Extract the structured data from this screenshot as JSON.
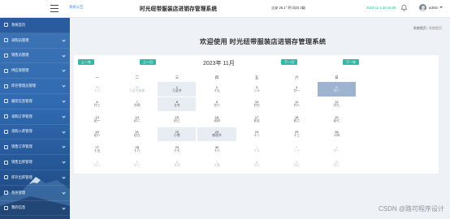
{
  "header": {
    "notice": "系统公告",
    "title": "时光纽带服装店进销存管理系统",
    "weather": "吉安  26.1°  阴  风向 2级",
    "datetime": "2023-11-1 20:18:29",
    "username": "admin"
  },
  "sidebar": {
    "items": [
      {
        "label": "系统首页",
        "active": true
      },
      {
        "label": "采购员管理"
      },
      {
        "label": "销售员管理"
      },
      {
        "label": "供应商管理"
      },
      {
        "label": "库存管理员管理"
      },
      {
        "label": "服装信息管理"
      },
      {
        "label": "采购订单管理"
      },
      {
        "label": "采购入库管理"
      },
      {
        "label": "销售订单管理"
      },
      {
        "label": "销售出库管理"
      },
      {
        "label": "库存出库管理"
      },
      {
        "label": "系统管理"
      },
      {
        "label": "我的信息"
      }
    ]
  },
  "breadcrumb": {
    "home": "系统首页",
    "current": "系统首页"
  },
  "welcome": "欢迎使用 时光纽带服装店进销存管理系统",
  "calendar": {
    "prev_year": "上一年",
    "prev_month": "上一月",
    "title": "2023年 11月",
    "next_month": "下一月",
    "next_year": "下一年",
    "weekdays": [
      "一",
      "二",
      "三",
      "四",
      "五",
      "六",
      "日"
    ],
    "weeks": [
      [
        {
          "d": "30",
          "l": "十六",
          "o": true
        },
        {
          "d": "31",
          "l": "万圣节前夜",
          "o": true
        },
        {
          "d": "1",
          "l": "万圣节",
          "h": true
        },
        {
          "d": "2",
          "l": "十九"
        },
        {
          "d": "3",
          "l": "二十"
        },
        {
          "d": "4",
          "l": "廿一"
        },
        {
          "d": "5",
          "l": "廿二",
          "s": true
        }
      ],
      [
        {
          "d": "6",
          "l": "廿三"
        },
        {
          "d": "7",
          "l": "廿四"
        },
        {
          "d": "8",
          "l": "立冬",
          "h": true
        },
        {
          "d": "9",
          "l": "廿六"
        },
        {
          "d": "10",
          "l": "廿七"
        },
        {
          "d": "11",
          "l": "廿八"
        },
        {
          "d": "12",
          "l": "廿九"
        }
      ],
      [
        {
          "d": "13",
          "l": "初一"
        },
        {
          "d": "14",
          "l": "初二"
        },
        {
          "d": "15",
          "l": "初三"
        },
        {
          "d": "16",
          "l": "初四"
        },
        {
          "d": "17",
          "l": "初五"
        },
        {
          "d": "18",
          "l": "初六"
        },
        {
          "d": "19",
          "l": "初七"
        }
      ],
      [
        {
          "d": "20",
          "l": "初八"
        },
        {
          "d": "21",
          "l": "初九"
        },
        {
          "d": "22",
          "l": "小雪",
          "h": true
        },
        {
          "d": "23",
          "l": "感恩节",
          "h": true
        },
        {
          "d": "24",
          "l": "十二"
        },
        {
          "d": "25",
          "l": "十三"
        },
        {
          "d": "26",
          "l": "十四"
        }
      ],
      [
        {
          "d": "27",
          "l": "十五"
        },
        {
          "d": "28",
          "l": "十六"
        },
        {
          "d": "29",
          "l": "十七"
        },
        {
          "d": "30",
          "l": "十八"
        },
        {
          "d": "1",
          "l": "十九",
          "o": true
        },
        {
          "d": "2",
          "l": "二十",
          "o": true
        },
        {
          "d": "3",
          "l": "廿一",
          "o": true
        }
      ],
      [
        {
          "d": "4",
          "l": "廿二",
          "o": true
        },
        {
          "d": "5",
          "l": "廿三",
          "o": true
        },
        {
          "d": "6",
          "l": "廿四",
          "o": true
        },
        {
          "d": "7",
          "l": "大雪",
          "o": true
        },
        {
          "d": "8",
          "l": "廿六",
          "o": true
        },
        {
          "d": "9",
          "l": "廿七",
          "o": true
        },
        {
          "d": "10",
          "l": "廿八",
          "o": true
        }
      ]
    ]
  },
  "watermark": "CSDN @路可程序设计",
  "colors": {
    "sidebar": "#2f69b0",
    "accent_button": "#37b8a7",
    "selected_day": "#9db3cf",
    "highlight_day": "#e8edf3"
  }
}
